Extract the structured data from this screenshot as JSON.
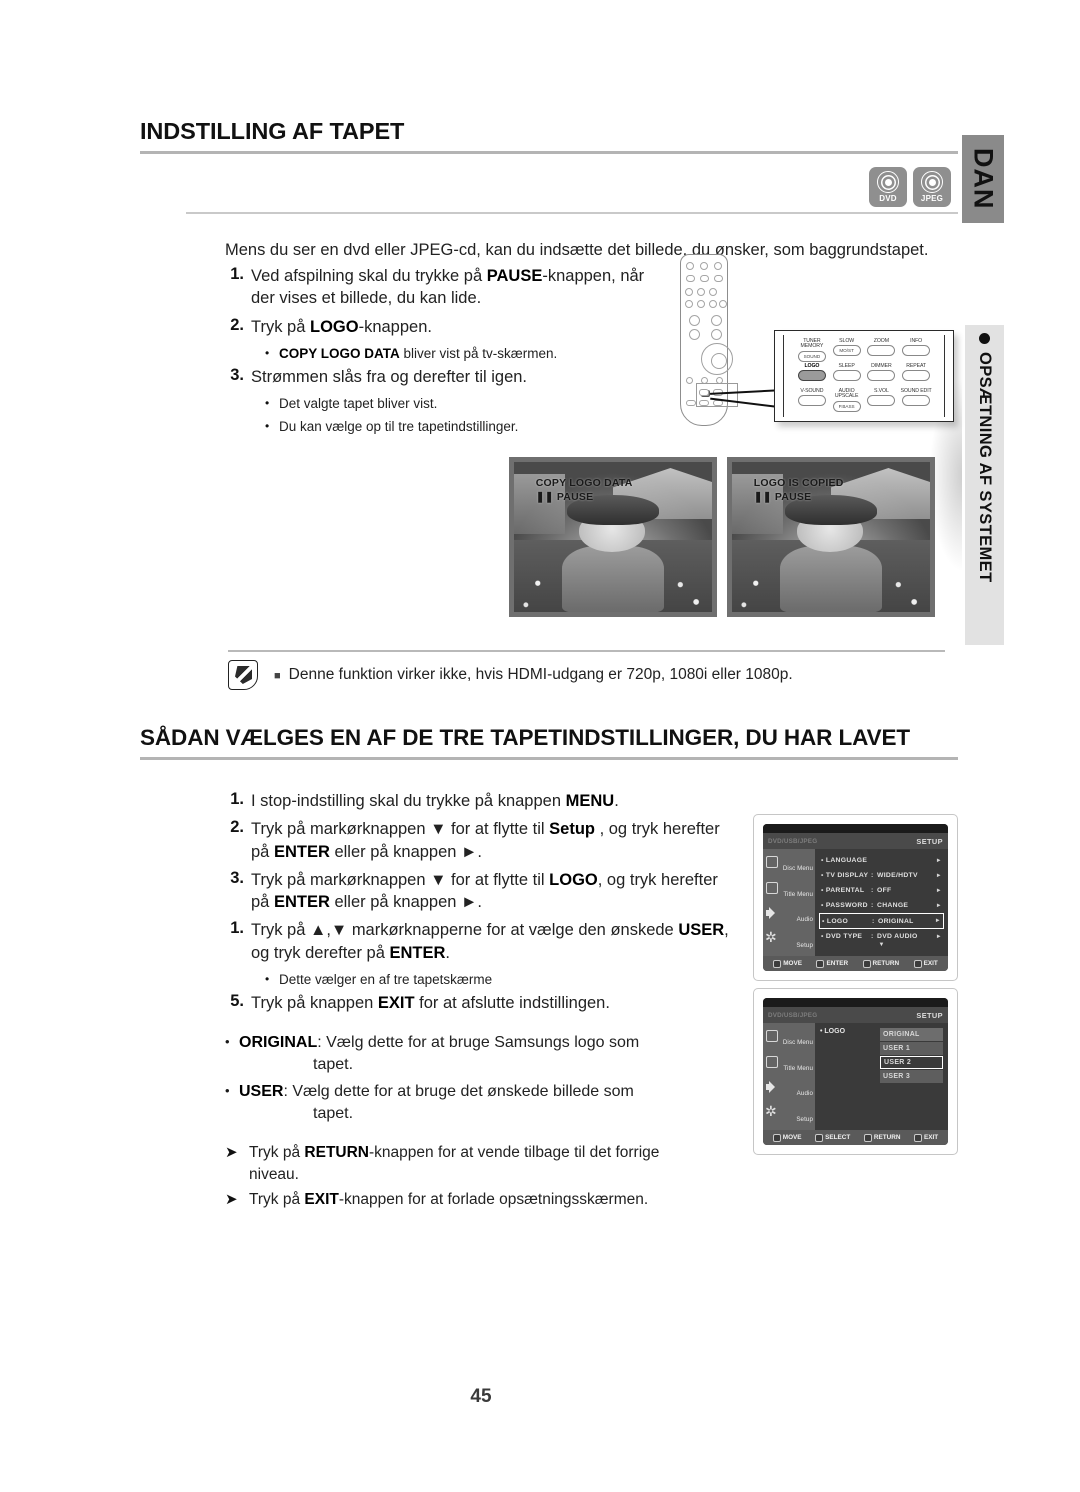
{
  "page": {
    "number": "45",
    "language_tab": "DAN",
    "section_tab": "OPSÆTNING AF SYSTEMET"
  },
  "section1": {
    "heading": "INDSTILLING AF TAPET",
    "disc_icons": [
      {
        "label": "DVD",
        "name": "dvd-disc-icon"
      },
      {
        "label": "JPEG",
        "name": "jpeg-disc-icon"
      }
    ],
    "intro": "Mens du ser en dvd eller JPEG-cd, kan du indsætte det billede, du ønsker, som baggrundstapet.",
    "steps": [
      {
        "num": "1.",
        "parts": [
          {
            "t": "Ved afspilning skal du trykke på ",
            "b": false
          },
          {
            "t": "PAUSE",
            "b": true
          },
          {
            "t": "-knappen, når der vises et billede, du kan lide.",
            "b": false
          }
        ],
        "subs": []
      },
      {
        "num": "2.",
        "parts": [
          {
            "t": "Tryk på ",
            "b": false
          },
          {
            "t": "LOGO",
            "b": true
          },
          {
            "t": "-knappen.",
            "b": false
          }
        ],
        "subs": [
          {
            "parts": [
              {
                "t": "COPY LOGO DATA",
                "b": true
              },
              {
                "t": " bliver vist på tv-skærmen.",
                "b": false
              }
            ]
          }
        ]
      },
      {
        "num": "3.",
        "parts": [
          {
            "t": "Strømmen slås fra og derefter til igen.",
            "b": false
          }
        ],
        "subs": [
          {
            "parts": [
              {
                "t": " Det valgte tapet bliver vist.",
                "b": false
              }
            ]
          },
          {
            "parts": [
              {
                "t": "Du kan vælge op til tre tapetindstillinger.",
                "b": false
              }
            ]
          }
        ]
      }
    ]
  },
  "remote_callout": {
    "buttons": [
      {
        "top": "TUNER\nMEMORY",
        "face": "SOUND",
        "active": false
      },
      {
        "top": "SLOW",
        "face": "MO/ST",
        "active": false
      },
      {
        "top": "ZOOM",
        "face": "",
        "active": false
      },
      {
        "top": "INFO",
        "face": "",
        "active": false
      },
      {
        "top": "LOGO",
        "face": "",
        "active": true
      },
      {
        "top": "SLEEP",
        "face": "",
        "active": false
      },
      {
        "top": "DIMMER",
        "face": "",
        "active": false
      },
      {
        "top": "REPEAT",
        "face": "",
        "active": false
      },
      {
        "top": "V-SOUND",
        "face": "",
        "active": false
      },
      {
        "top": "AUDIO\nUPSCALE",
        "face": "P.BASS",
        "active": false
      },
      {
        "top": "S.VOL",
        "face": "",
        "active": false
      },
      {
        "top": "SOUND EDIT",
        "face": "",
        "active": false
      }
    ]
  },
  "tv_shots": [
    {
      "name": "copy-logo-data-screen",
      "line1": "COPY LOGO DATA",
      "line2": "❚❚ PAUSE"
    },
    {
      "name": "logo-is-copied-screen",
      "line1": "LOGO IS COPIED",
      "line2": "❚❚ PAUSE"
    }
  ],
  "note": {
    "marker": "■",
    "text": "Denne funktion virker ikke, hvis HDMI-udgang er 720p, 1080i eller 1080p."
  },
  "section2": {
    "heading": "SÅDAN VÆLGES EN AF DE TRE TAPETINDSTILLINGER, DU HAR LAVET",
    "steps": [
      {
        "num": "1.",
        "parts": [
          {
            "t": "I stop-indstilling skal du trykke på knappen ",
            "b": false
          },
          {
            "t": "MENU",
            "b": true
          },
          {
            "t": ".",
            "b": false
          }
        ],
        "subs": []
      },
      {
        "num": "2.",
        "parts": [
          {
            "t": "Tryk på markørknappen ▼ for at flytte til ",
            "b": false
          },
          {
            "t": "Setup",
            "b": true
          },
          {
            "t": " , og tryk herefter på ",
            "b": false
          },
          {
            "t": "ENTER",
            "b": true
          },
          {
            "t": " eller på knappen ►.",
            "b": false
          }
        ],
        "subs": []
      },
      {
        "num": "3.",
        "parts": [
          {
            "t": "Tryk på markørknappen ▼  for at flytte til ",
            "b": false
          },
          {
            "t": "LOGO",
            "b": true
          },
          {
            "t": ", og tryk herefter på ",
            "b": false
          },
          {
            "t": "ENTER",
            "b": true
          },
          {
            "t": " eller på knappen ►.",
            "b": false
          }
        ],
        "subs": []
      },
      {
        "num": "1.",
        "parts": [
          {
            "t": "Tryk på ▲,▼ markørknapperne for at vælge den ønskede ",
            "b": false
          },
          {
            "t": "USER",
            "b": true
          },
          {
            "t": ", og tryk derefter på ",
            "b": false
          },
          {
            "t": "ENTER",
            "b": true
          },
          {
            "t": ".",
            "b": false
          }
        ],
        "subs": [
          {
            "parts": [
              {
                "t": "Dette vælger en af tre tapetskærme",
                "b": false
              }
            ]
          }
        ]
      },
      {
        "num": "5.",
        "parts": [
          {
            "t": "Tryk på knappen ",
            "b": false
          },
          {
            "t": "EXIT",
            "b": true
          },
          {
            "t": " for at afslutte indstillingen.",
            "b": false
          }
        ],
        "subs": []
      }
    ],
    "bullets": [
      {
        "parts": [
          {
            "t": "ORIGINAL",
            "b": true
          },
          {
            "t": ": Vælg dette for at bruge Samsungs logo som",
            "b": false
          }
        ],
        "indent": "tapet."
      },
      {
        "parts": [
          {
            "t": "USER",
            "b": true
          },
          {
            "t": ": Vælg dette for at bruge det ønskede billede som",
            "b": false
          }
        ],
        "indent": "tapet."
      }
    ],
    "arrows": [
      {
        "parts": [
          {
            "t": "Tryk på ",
            "b": false
          },
          {
            "t": "RETURN",
            "b": true
          },
          {
            "t": "-knappen for at vende tilbage til det forrige niveau.",
            "b": false
          }
        ]
      },
      {
        "parts": [
          {
            "t": "Tryk på ",
            "b": false
          },
          {
            "t": "EXIT",
            "b": true
          },
          {
            "t": "-knappen for at forlade opsætningsskærmen.",
            "b": false
          }
        ]
      }
    ]
  },
  "osd_menu_1": {
    "title_left": "DVD/USB/JPEG",
    "title_right": "SETUP",
    "sidebar": [
      {
        "label": "Disc Menu",
        "icon": "disc-menu-icon"
      },
      {
        "label": "Title Menu",
        "icon": "title-menu-icon"
      },
      {
        "label": "Audio",
        "icon": "speaker-icon"
      },
      {
        "label": "Setup",
        "icon": "gear-icon"
      }
    ],
    "rows": [
      {
        "key": "LANGUAGE",
        "value": "",
        "selected": false
      },
      {
        "key": "TV DISPLAY",
        "value": "WIDE/HDTV",
        "selected": false
      },
      {
        "key": "PARENTAL",
        "value": "OFF",
        "selected": false
      },
      {
        "key": "PASSWORD",
        "value": "CHANGE",
        "selected": false
      },
      {
        "key": "LOGO",
        "value": "ORIGINAL",
        "selected": true
      },
      {
        "key": "DVD TYPE",
        "value": "DVD AUDIO",
        "selected": false
      }
    ],
    "footer": [
      "MOVE",
      "ENTER",
      "RETURN",
      "EXIT"
    ]
  },
  "osd_menu_2": {
    "title_left": "DVD/USB/JPEG",
    "title_right": "SETUP",
    "sidebar": [
      {
        "label": "Disc Menu",
        "icon": "disc-menu-icon"
      },
      {
        "label": "Title Menu",
        "icon": "title-menu-icon"
      },
      {
        "label": "Audio",
        "icon": "speaker-icon"
      },
      {
        "label": "Setup",
        "icon": "gear-icon"
      }
    ],
    "label": "LOGO",
    "options": [
      {
        "label": "ORIGINAL",
        "selected": false
      },
      {
        "label": "USER 1",
        "selected": false
      },
      {
        "label": "USER 2",
        "selected": true
      },
      {
        "label": "USER 3",
        "selected": false
      }
    ],
    "footer": [
      "MOVE",
      "SELECT",
      "RETURN",
      "EXIT"
    ]
  }
}
